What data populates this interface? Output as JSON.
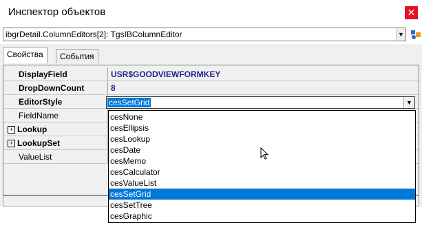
{
  "window": {
    "title": "Инспектор объектов",
    "close_glyph": "✕"
  },
  "object_selector": {
    "value": "ibgrDetail.ColumnEditors[2]: TgsIBColumnEditor",
    "arrow": "▼",
    "side_icon": "component-icon"
  },
  "tabs": [
    {
      "label": "Свойства",
      "active": true
    },
    {
      "label": "События",
      "active": false
    }
  ],
  "properties": [
    {
      "name": "DisplayField",
      "value": "USR$GOODVIEWFORMKEY",
      "bold": true,
      "expandable": false
    },
    {
      "name": "DropDownCount",
      "value": "8",
      "bold": true,
      "expandable": false
    },
    {
      "name": "EditorStyle",
      "value": "cesSetGrid",
      "bold": true,
      "expandable": false
    },
    {
      "name": "FieldName",
      "value": "",
      "bold": false,
      "expandable": false
    },
    {
      "name": "Lookup",
      "value": "",
      "bold": true,
      "expandable": true
    },
    {
      "name": "LookupSet",
      "value": "",
      "bold": true,
      "expandable": true
    },
    {
      "name": "ValueList",
      "value": "",
      "bold": false,
      "expandable": false
    }
  ],
  "editor_style_dropdown": {
    "arrow": "▼",
    "selected": "cesSetGrid",
    "options": [
      "cesNone",
      "cesEllipsis",
      "cesLookup",
      "cesDate",
      "cesMemo",
      "cesCalculator",
      "cesValueList",
      "cesSetGrid",
      "cesSetTree",
      "cesGraphic"
    ]
  },
  "colors": {
    "selection": "#0078d7",
    "value_blue": "#1f1f8f",
    "close_red": "#e81123"
  }
}
